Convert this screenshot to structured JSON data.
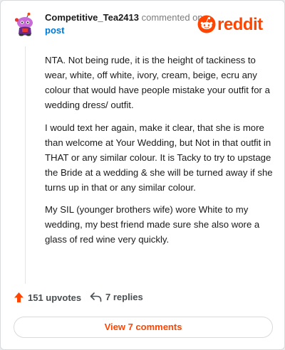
{
  "comment": {
    "author": "Competitive_Tea2413",
    "action_text": "commented on",
    "target": "post",
    "paragraphs": [
      "NTA. Not being rude, it is the height of tackiness to wear, white, off white, ivory, cream, beige, ecru any colour that would have people mistake your outfit for a wedding dress/ outfit.",
      "I would text her again, make it clear, that she is more than welcome at Your Wedding, but Not in that outfit in THAT or any similar colour. It is Tacky to try to upstage the Bride at a wedding & she will be turned away if she turns up in that or any similar colour.",
      "My SIL (younger brothers wife) wore White to my wedding, my best friend made sure she also wore a glass of red wine very quickly."
    ]
  },
  "brand": {
    "name": "reddit",
    "color": "#ff4500"
  },
  "actions": {
    "upvotes_label": "151 upvotes",
    "replies_label": "7 replies",
    "upvote_icon": "upvote-arrow-icon",
    "reply_icon": "reply-arrow-icon"
  },
  "view_button_label": "View 7 comments",
  "colors": {
    "accent": "#ff4500",
    "link": "#0079d3",
    "muted": "#7c7c7c"
  }
}
